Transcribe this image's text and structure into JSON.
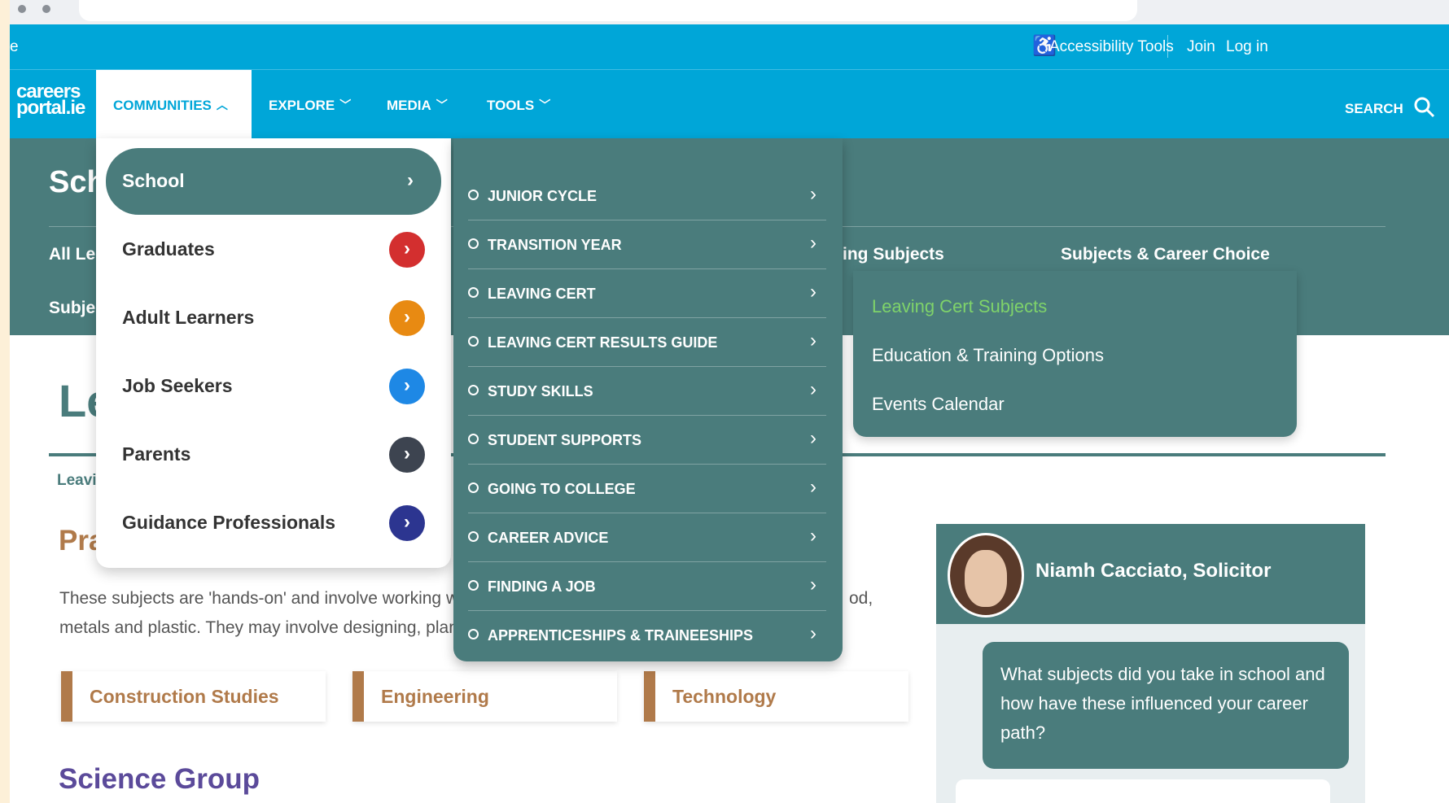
{
  "topbar": {
    "left_fragment": "e",
    "accessibility": "Accessibility Tools",
    "join": "Join",
    "login": "Log in"
  },
  "logo": {
    "line1": "careers",
    "line2": "portal.ie"
  },
  "nav": {
    "items": [
      {
        "label": "COMMUNITIES",
        "caret": "︿"
      },
      {
        "label": "EXPLORE",
        "caret": "﹀"
      },
      {
        "label": "MEDIA",
        "caret": "﹀"
      },
      {
        "label": "TOOLS",
        "caret": "﹀"
      }
    ],
    "search": "SEARCH"
  },
  "banner": {
    "title_fragment": "Sch",
    "row1_fragment": "All Le",
    "row2_fragment": "Subje",
    "link_choosing": "ing Subjects",
    "link_career_choice": "Subjects & Career Choice"
  },
  "page": {
    "heading_fragment": "Le",
    "crumb_fragment": "Leavi",
    "section_fragment": "Pra",
    "para_line1_a": "These subjects are 'hands-on' and involve working w",
    "para_line1_b": "od,",
    "para_line2": "metals and plastic. They may involve designing, plan",
    "cards": [
      "Construction Studies",
      "Engineering",
      "Technology"
    ],
    "science_heading": "Science Group"
  },
  "sidebar": {
    "name": "Niamh Cacciato, Solicitor",
    "question": "What subjects did you take in school and how have these influenced your career path?"
  },
  "communities_menu": [
    {
      "label": "School",
      "color": "#4a7c7c"
    },
    {
      "label": "Graduates",
      "color": "#d32f2f"
    },
    {
      "label": "Adult Learners",
      "color": "#e88a12"
    },
    {
      "label": "Job Seekers",
      "color": "#1e88e5"
    },
    {
      "label": "Parents",
      "color": "#3d4450"
    },
    {
      "label": "Guidance Professionals",
      "color": "#2c3590"
    }
  ],
  "chevron": "›",
  "school_menu": [
    "JUNIOR CYCLE",
    "TRANSITION YEAR",
    "LEAVING CERT",
    "LEAVING CERT RESULTS GUIDE",
    "STUDY SKILLS",
    "STUDENT SUPPORTS",
    "GOING TO COLLEGE",
    "CAREER ADVICE",
    "FINDING A JOB",
    "APPRENTICESHIPS & TRAINEESHIPS"
  ],
  "flyout": [
    {
      "label": "Leaving Cert Subjects",
      "active": true
    },
    {
      "label": "Education & Training Options",
      "active": false
    },
    {
      "label": "Events Calendar",
      "active": false
    }
  ],
  "colors": {
    "accent_blue": "#00a6d8",
    "teal": "#4a7c7c",
    "brown": "#b07a4a",
    "purple": "#5b4a9a",
    "active_green": "#7fd36a"
  }
}
